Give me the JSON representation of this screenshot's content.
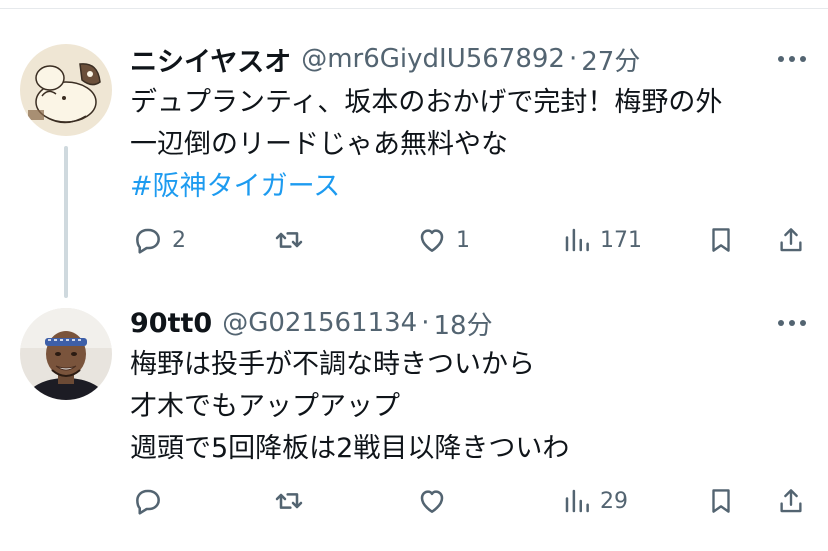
{
  "tweets": [
    {
      "name": "ニシイヤスオ",
      "handle": "@mr6GiydIU567892",
      "separator": "·",
      "time": "27分",
      "lines": [
        "デュプランティ、坂本のおかげで完封！梅野の外",
        "一辺倒のリードじゃあ無料やな"
      ],
      "hashtag": "#阪神タイガース",
      "replies": "2",
      "retweets": "",
      "likes": "1",
      "views": "171",
      "avatar": "dog-illustration-avatar"
    },
    {
      "name": "90tt0",
      "handle": "@G021561134",
      "separator": "·",
      "time": "18分",
      "lines": [
        "梅野は投手が不調な時きついから",
        "才木でもアップアップ",
        "週頭で5回降板は2戦目以降きついわ"
      ],
      "replies": "",
      "retweets": "",
      "likes": "",
      "views": "29",
      "avatar": "person-photo-avatar"
    }
  ],
  "colors": {
    "text": "#0f1419",
    "secondary": "#536471",
    "link": "#1d9bf0",
    "thread_line": "#cfd9de"
  },
  "icons": [
    "reply-icon",
    "retweet-icon",
    "like-icon",
    "views-icon",
    "bookmark-icon",
    "share-icon",
    "more-icon"
  ]
}
